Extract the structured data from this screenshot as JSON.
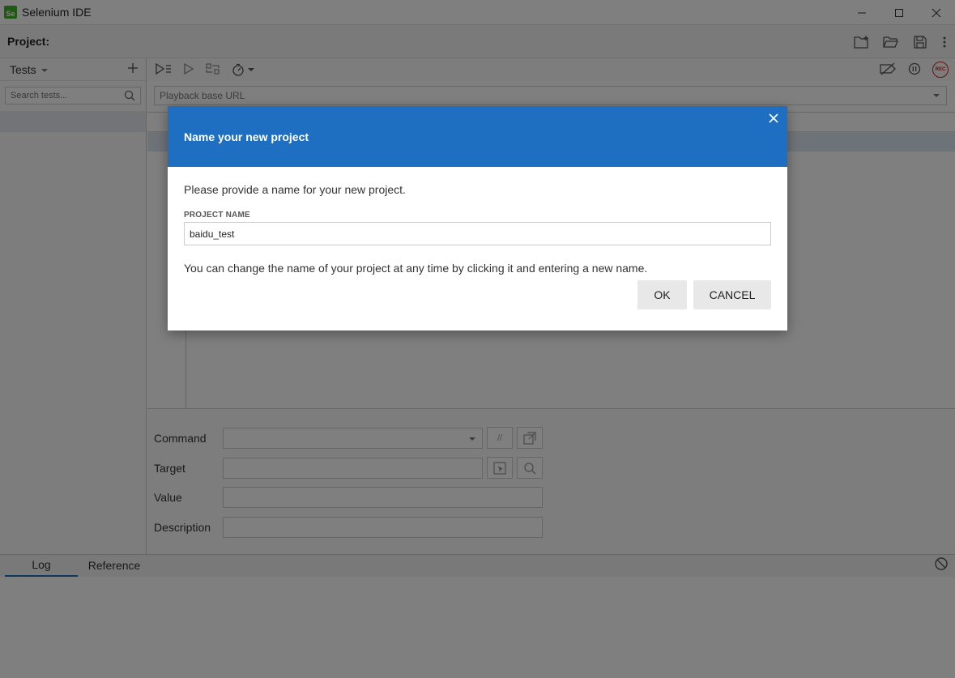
{
  "window": {
    "app_logo_text": "Se",
    "title": "Selenium IDE",
    "minimize_icon": "minimize-icon",
    "maximize_icon": "maximize-icon",
    "close_icon": "close-icon"
  },
  "project": {
    "label": "Project:",
    "actions": [
      "new-project-icon",
      "open-project-icon",
      "save-project-icon",
      "more-options-icon"
    ]
  },
  "sidebar": {
    "title": "Tests",
    "add_icon": "plus-icon",
    "search_placeholder": "Search tests...",
    "search_icon": "search-icon"
  },
  "toolbar": {
    "left_icons": [
      "run-all-tests-icon",
      "run-current-test-icon",
      "step-over-icon",
      "speed-icon"
    ],
    "right_icons": [
      "disable-breakpoints-icon",
      "pause-on-exceptions-icon"
    ],
    "record_label": "REC"
  },
  "url_bar": {
    "placeholder": "Playback base URL"
  },
  "command_panel": {
    "command_label": "Command",
    "target_label": "Target",
    "value_label": "Value",
    "description_label": "Description",
    "comment_btn": "//",
    "command_value": "",
    "target_value": "",
    "value_value": "",
    "description_value": ""
  },
  "log_panel": {
    "tabs": [
      "Log",
      "Reference"
    ],
    "active_tab": "Log",
    "clear_icon": "clear-log-icon"
  },
  "modal": {
    "title": "Name your new project",
    "description": "Please provide a name for your new project.",
    "field_label": "PROJECT NAME",
    "field_value": "baidu_test",
    "hint": "You can change the name of your project at any time by clicking it and entering a new name.",
    "ok_label": "OK",
    "cancel_label": "CANCEL"
  },
  "colors": {
    "modal_header": "#1e6fc1",
    "record": "#c62828",
    "logo": "#43b02a"
  }
}
